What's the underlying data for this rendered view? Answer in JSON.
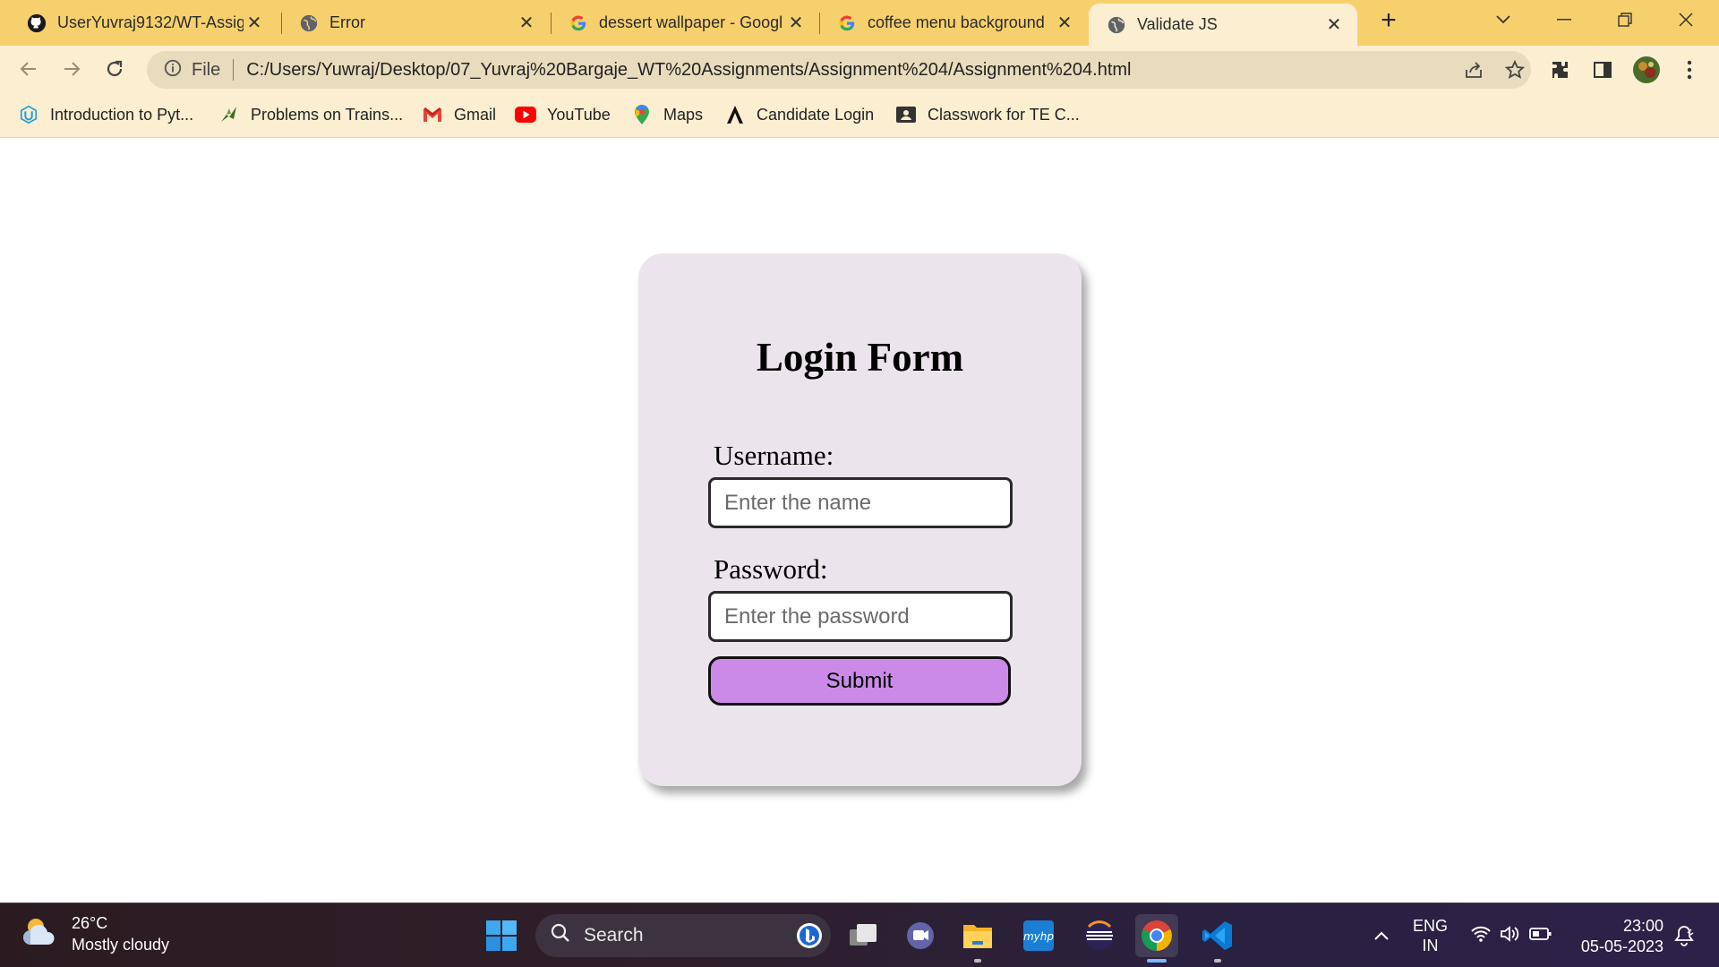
{
  "browser": {
    "tabs": [
      {
        "title": "UserYuvraj9132/WT-Assig",
        "icon": "github-icon"
      },
      {
        "title": "Error",
        "icon": "globe-icon"
      },
      {
        "title": "dessert wallpaper - Googl",
        "icon": "google-icon"
      },
      {
        "title": "coffee menu background",
        "icon": "google-icon"
      },
      {
        "title": "Validate JS",
        "icon": "globe-icon",
        "active": true
      }
    ],
    "new_tab": "+",
    "address": {
      "scheme_label": "File",
      "url": "C:/Users/Yuwraj/Desktop/07_Yuvraj%20Bargaje_WT%20Assignments/Assignment%204/Assignment%204.html"
    },
    "bookmarks": [
      {
        "label": "Introduction to Pyt...",
        "icon": "udacity-icon"
      },
      {
        "label": "Problems on Trains...",
        "icon": "bird-icon"
      },
      {
        "label": "Gmail",
        "icon": "gmail-icon"
      },
      {
        "label": "YouTube",
        "icon": "youtube-icon"
      },
      {
        "label": "Maps",
        "icon": "maps-icon"
      },
      {
        "label": "Candidate Login",
        "icon": "letter-a-icon"
      },
      {
        "label": "Classwork for TE C...",
        "icon": "classroom-icon"
      }
    ]
  },
  "form": {
    "title": "Login Form",
    "username_label": "Username:",
    "username_placeholder": "Enter the name",
    "password_label": "Password:",
    "password_placeholder": "Enter the password",
    "submit_label": "Submit",
    "card_color": "#ece4ec",
    "button_color": "#cb8ae8"
  },
  "taskbar": {
    "weather_temp": "26°C",
    "weather_desc": "Mostly cloudy",
    "search_label": "Search",
    "lang_1": "ENG",
    "lang_2": "IN",
    "time": "23:00",
    "date": "05-05-2023"
  }
}
